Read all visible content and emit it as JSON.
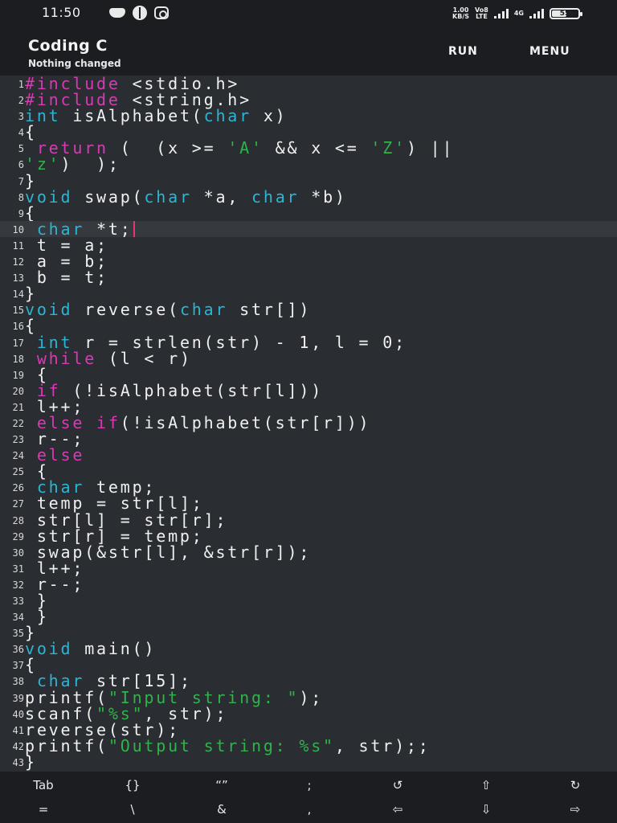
{
  "status_bar": {
    "time": "11:50",
    "icons_left": [
      "discord-icon",
      "game-icon",
      "instagram-icon"
    ],
    "speed_value": "1.00",
    "speed_unit": "KB/S",
    "volte_top": "Vo8",
    "volte_bottom": "LTE",
    "signal_label": "4G",
    "battery_level": 55,
    "battery_text": "55"
  },
  "app_bar": {
    "title": "Coding C",
    "subtitle": "Nothing changed",
    "run_label": "RUN",
    "menu_label": "MENU"
  },
  "editor": {
    "current_line": 10,
    "lines": [
      {
        "n": "1",
        "tokens": [
          [
            "k",
            "#include"
          ],
          [
            "p",
            " <stdio.h>"
          ]
        ]
      },
      {
        "n": "2",
        "tokens": [
          [
            "k",
            "#include"
          ],
          [
            "p",
            " <string.h>"
          ]
        ]
      },
      {
        "n": "3",
        "tokens": [
          [
            "t",
            "int"
          ],
          [
            "p",
            " isAlphabet("
          ],
          [
            "t",
            "char"
          ],
          [
            "p",
            " x)"
          ]
        ]
      },
      {
        "n": "4",
        "tokens": [
          [
            "p",
            "{"
          ]
        ]
      },
      {
        "n": "5",
        "tokens": [
          [
            "p",
            " "
          ],
          [
            "k",
            "return"
          ],
          [
            "p",
            " (  (x >= "
          ],
          [
            "s",
            "'A'"
          ],
          [
            "p",
            " && x <= "
          ],
          [
            "s",
            "'Z'"
          ],
          [
            "p",
            ") ||"
          ]
        ]
      },
      {
        "n": "6",
        "tokens": [
          [
            "s",
            "'z'"
          ],
          [
            "p",
            ")  );"
          ]
        ]
      },
      {
        "n": "7",
        "tokens": [
          [
            "p",
            "}"
          ]
        ]
      },
      {
        "n": "8",
        "tokens": [
          [
            "t",
            "void"
          ],
          [
            "p",
            " swap("
          ],
          [
            "t",
            "char"
          ],
          [
            "p",
            " *a, "
          ],
          [
            "t",
            "char"
          ],
          [
            "p",
            " *b)"
          ]
        ]
      },
      {
        "n": "9",
        "tokens": [
          [
            "p",
            "{"
          ]
        ]
      },
      {
        "n": "10",
        "tokens": [
          [
            "p",
            " "
          ],
          [
            "t",
            "char"
          ],
          [
            "p",
            " *t;"
          ]
        ]
      },
      {
        "n": "11",
        "tokens": [
          [
            "p",
            " t = a;"
          ]
        ]
      },
      {
        "n": "12",
        "tokens": [
          [
            "p",
            " a = b;"
          ]
        ]
      },
      {
        "n": "13",
        "tokens": [
          [
            "p",
            " b = t;"
          ]
        ]
      },
      {
        "n": "14",
        "tokens": [
          [
            "p",
            "}"
          ]
        ]
      },
      {
        "n": "15",
        "tokens": [
          [
            "t",
            "void"
          ],
          [
            "p",
            " reverse("
          ],
          [
            "t",
            "char"
          ],
          [
            "p",
            " str[])"
          ]
        ]
      },
      {
        "n": "16",
        "tokens": [
          [
            "p",
            "{"
          ]
        ]
      },
      {
        "n": "17",
        "tokens": [
          [
            "p",
            " "
          ],
          [
            "t",
            "int"
          ],
          [
            "p",
            " r = strlen(str) - 1, l = 0;"
          ]
        ]
      },
      {
        "n": "18",
        "tokens": [
          [
            "p",
            " "
          ],
          [
            "k",
            "while"
          ],
          [
            "p",
            " (l < r)"
          ]
        ]
      },
      {
        "n": "19",
        "tokens": [
          [
            "p",
            " {"
          ]
        ]
      },
      {
        "n": "20",
        "tokens": [
          [
            "p",
            " "
          ],
          [
            "k",
            "if"
          ],
          [
            "p",
            " (!isAlphabet(str[l]))"
          ]
        ]
      },
      {
        "n": "21",
        "tokens": [
          [
            "p",
            " l++;"
          ]
        ]
      },
      {
        "n": "22",
        "tokens": [
          [
            "p",
            " "
          ],
          [
            "k",
            "else if"
          ],
          [
            "p",
            "(!isAlphabet(str[r]))"
          ]
        ]
      },
      {
        "n": "23",
        "tokens": [
          [
            "p",
            " r--;"
          ]
        ]
      },
      {
        "n": "24",
        "tokens": [
          [
            "p",
            " "
          ],
          [
            "k",
            "else"
          ]
        ]
      },
      {
        "n": "25",
        "tokens": [
          [
            "p",
            " {"
          ]
        ]
      },
      {
        "n": "26",
        "tokens": [
          [
            "p",
            " "
          ],
          [
            "t",
            "char"
          ],
          [
            "p",
            " temp;"
          ]
        ]
      },
      {
        "n": "27",
        "tokens": [
          [
            "p",
            " temp = str[l];"
          ]
        ]
      },
      {
        "n": "28",
        "tokens": [
          [
            "p",
            " str[l] = str[r];"
          ]
        ]
      },
      {
        "n": "29",
        "tokens": [
          [
            "p",
            " str[r] = temp;"
          ]
        ]
      },
      {
        "n": "30",
        "tokens": [
          [
            "p",
            " swap(&str[l], &str[r]);"
          ]
        ]
      },
      {
        "n": "31",
        "tokens": [
          [
            "p",
            " l++;"
          ]
        ]
      },
      {
        "n": "32",
        "tokens": [
          [
            "p",
            " r--;"
          ]
        ]
      },
      {
        "n": "33",
        "tokens": [
          [
            "p",
            " }"
          ]
        ]
      },
      {
        "n": "34",
        "tokens": [
          [
            "p",
            " }"
          ]
        ]
      },
      {
        "n": "35",
        "tokens": [
          [
            "p",
            "}"
          ]
        ]
      },
      {
        "n": "36",
        "tokens": [
          [
            "t",
            "void"
          ],
          [
            "p",
            " main()"
          ]
        ]
      },
      {
        "n": "37",
        "tokens": [
          [
            "p",
            "{"
          ]
        ]
      },
      {
        "n": "38",
        "tokens": [
          [
            "p",
            " "
          ],
          [
            "t",
            "char"
          ],
          [
            "p",
            " str[15];"
          ]
        ]
      },
      {
        "n": "39",
        "tokens": [
          [
            "p",
            "printf("
          ],
          [
            "s",
            "\"Input string: \""
          ],
          [
            "p",
            ");"
          ]
        ]
      },
      {
        "n": "40",
        "tokens": [
          [
            "p",
            "scanf("
          ],
          [
            "s",
            "\"%s\""
          ],
          [
            "p",
            ", str);"
          ]
        ]
      },
      {
        "n": "41",
        "tokens": [
          [
            "p",
            "reverse(str);"
          ]
        ]
      },
      {
        "n": "42",
        "tokens": [
          [
            "p",
            "printf("
          ],
          [
            "s",
            "\"Output string: %s\""
          ],
          [
            "p",
            ", str);;"
          ]
        ]
      },
      {
        "n": "43",
        "tokens": [
          [
            "p",
            "}"
          ]
        ]
      }
    ]
  },
  "extra_keys": {
    "row1": [
      {
        "label": "Tab",
        "name": "tab-key"
      },
      {
        "label": "{}",
        "name": "braces-key"
      },
      {
        "label": "“”",
        "name": "quotes-key"
      },
      {
        "label": ";",
        "name": "semicolon-key"
      },
      {
        "label": "↺",
        "name": "undo-key"
      },
      {
        "label": "⇧",
        "name": "up-arrow-key"
      },
      {
        "label": "↻",
        "name": "redo-key"
      }
    ],
    "row2": [
      {
        "label": "=",
        "name": "equals-key"
      },
      {
        "label": "\\",
        "name": "backslash-key"
      },
      {
        "label": "&",
        "name": "ampersand-key"
      },
      {
        "label": ",",
        "name": "comma-key"
      },
      {
        "label": "⇦",
        "name": "left-arrow-key"
      },
      {
        "label": "⇩",
        "name": "down-arrow-key"
      },
      {
        "label": "⇨",
        "name": "right-arrow-key"
      }
    ]
  }
}
